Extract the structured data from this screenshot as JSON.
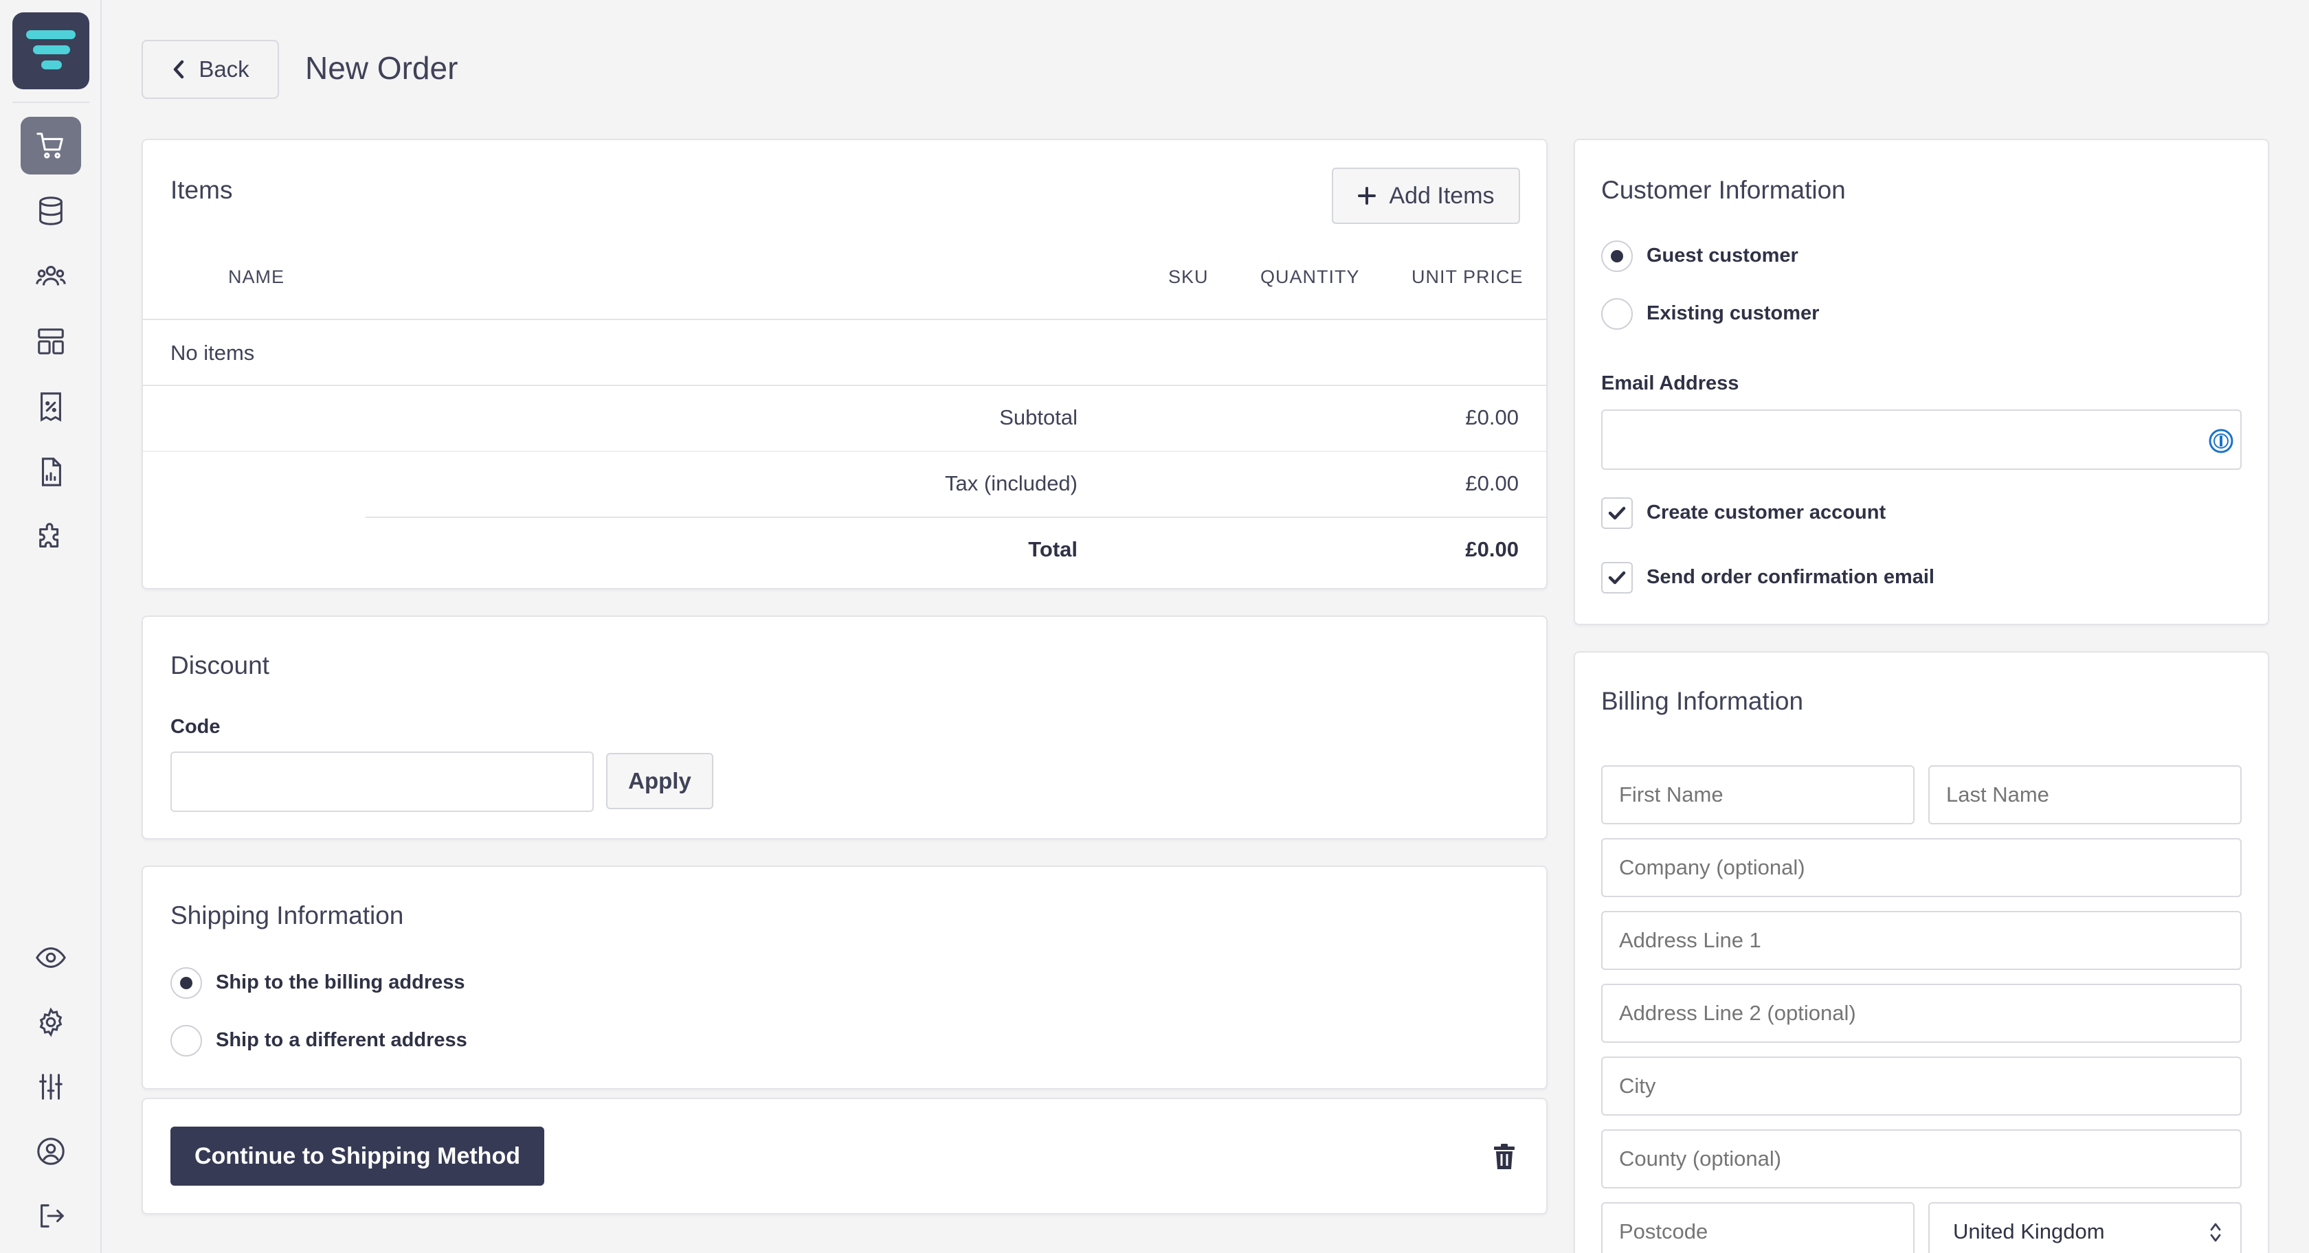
{
  "header": {
    "back_label": "Back",
    "title": "New Order"
  },
  "sidebar": {
    "items": [
      {
        "icon": "cart-icon",
        "active": true
      },
      {
        "icon": "database-icon"
      },
      {
        "icon": "users-icon"
      },
      {
        "icon": "layout-icon"
      },
      {
        "icon": "receipt-percent-icon"
      },
      {
        "icon": "report-icon"
      },
      {
        "icon": "puzzle-icon"
      }
    ],
    "bottom_items": [
      {
        "icon": "eye-icon"
      },
      {
        "icon": "gear-icon"
      },
      {
        "icon": "sliders-icon"
      },
      {
        "icon": "user-circle-icon"
      },
      {
        "icon": "logout-icon"
      }
    ]
  },
  "items_card": {
    "title": "Items",
    "add_label": "Add Items",
    "columns": [
      "NAME",
      "SKU",
      "QUANTITY",
      "UNIT PRICE"
    ],
    "empty_text": "No items",
    "subtotal_label": "Subtotal",
    "subtotal_value": "£0.00",
    "tax_label": "Tax (included)",
    "tax_value": "£0.00",
    "total_label": "Total",
    "total_value": "£0.00"
  },
  "discount_card": {
    "title": "Discount",
    "code_label": "Code",
    "code_value": "",
    "apply_label": "Apply"
  },
  "shipping_card": {
    "title": "Shipping Information",
    "options": [
      {
        "label": "Ship to the billing address",
        "checked": true
      },
      {
        "label": "Ship to a different address",
        "checked": false
      }
    ]
  },
  "footer_card": {
    "continue_label": "Continue to Shipping Method"
  },
  "customer_card": {
    "title": "Customer Information",
    "options": [
      {
        "label": "Guest customer",
        "checked": true
      },
      {
        "label": "Existing customer",
        "checked": false
      }
    ],
    "email_label": "Email Address",
    "email_value": "",
    "checks": [
      {
        "label": "Create customer account",
        "checked": true
      },
      {
        "label": "Send order confirmation email",
        "checked": true
      }
    ]
  },
  "billing_card": {
    "title": "Billing Information",
    "first_name_placeholder": "First Name",
    "last_name_placeholder": "Last Name",
    "company_placeholder": "Company (optional)",
    "address1_placeholder": "Address Line 1",
    "address2_placeholder": "Address Line 2 (optional)",
    "city_placeholder": "City",
    "county_placeholder": "County (optional)",
    "postcode_placeholder": "Postcode",
    "country_value": "United Kingdom"
  },
  "colors": {
    "primary": "#363a54",
    "sidebar_active": "#717586",
    "logo_accent": "#4fd1d9"
  }
}
